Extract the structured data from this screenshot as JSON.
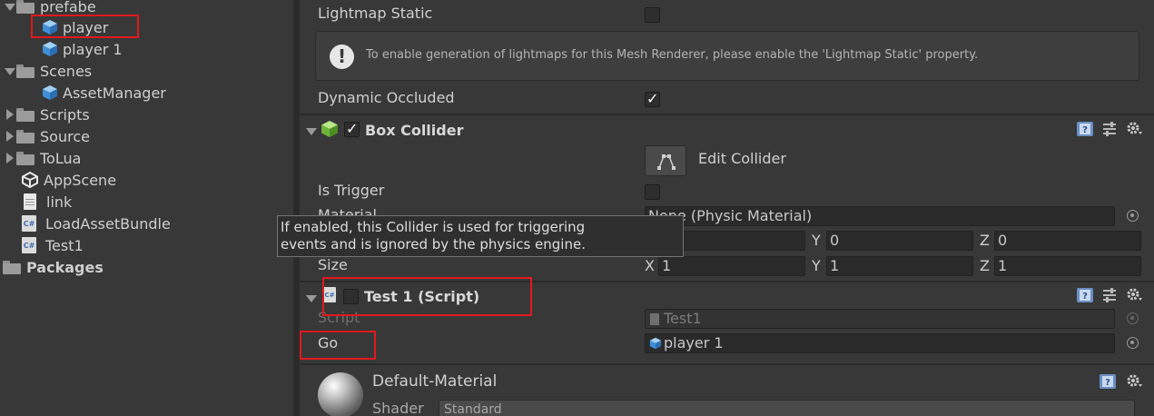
{
  "project": {
    "items": [
      {
        "label": "prefabe",
        "icon": "folder-icon",
        "expanded": true
      },
      {
        "label": "player",
        "icon": "prefab-cube-icon"
      },
      {
        "label": "player 1",
        "icon": "prefab-cube-icon"
      },
      {
        "label": "Scenes",
        "icon": "folder-icon",
        "expanded": true
      },
      {
        "label": "AssetManager",
        "icon": "prefab-cube-icon"
      },
      {
        "label": "Scripts",
        "icon": "folder-icon",
        "expanded": false
      },
      {
        "label": "Source",
        "icon": "folder-icon",
        "expanded": false
      },
      {
        "label": "ToLua",
        "icon": "folder-icon",
        "expanded": false
      },
      {
        "label": "AppScene",
        "icon": "unity-scene-icon"
      },
      {
        "label": "link",
        "icon": "text-file-icon"
      },
      {
        "label": "LoadAssetBundle",
        "icon": "csharp-script-icon"
      },
      {
        "label": "Test1",
        "icon": "csharp-script-icon"
      },
      {
        "label": "Packages",
        "icon": "folder-icon"
      }
    ],
    "cs_glyph": "C#"
  },
  "inspector": {
    "lightmap_static": {
      "label": "Lightmap Static",
      "checked": false
    },
    "help_box": {
      "icon": "!",
      "text": "To enable generation of lightmaps for this Mesh Renderer, please enable the 'Lightmap Static' property."
    },
    "dynamic_occluded": {
      "label": "Dynamic Occluded",
      "checked": true
    },
    "box_collider": {
      "title": "Box Collider",
      "enabled": true,
      "edit_collider_label": "Edit Collider",
      "is_trigger": {
        "label": "Is Trigger",
        "checked": false
      },
      "material": {
        "label": "Material",
        "value": "None (Physic Material)"
      },
      "center": {
        "x": "",
        "y": "0",
        "z": "0"
      },
      "size": {
        "label": "Size",
        "x": "1",
        "y": "1",
        "z": "1"
      },
      "axis": {
        "x": "X",
        "y": "Y",
        "z": "Z"
      },
      "tooltip_line1": "If enabled, this Collider is used for triggering",
      "tooltip_line2": "events and is ignored by the physics engine."
    },
    "test_script": {
      "title": "Test 1 (Script)",
      "enabled": false,
      "script": {
        "label": "Script",
        "value": "Test1"
      },
      "go": {
        "label": "Go",
        "value": "player 1"
      }
    },
    "material": {
      "title": "Default-Material",
      "shader": {
        "label": "Shader",
        "value": "Standard"
      }
    }
  },
  "colors": {
    "background": "#383838",
    "highlight_box": "#e0191f",
    "field": "#2a2a2a"
  }
}
